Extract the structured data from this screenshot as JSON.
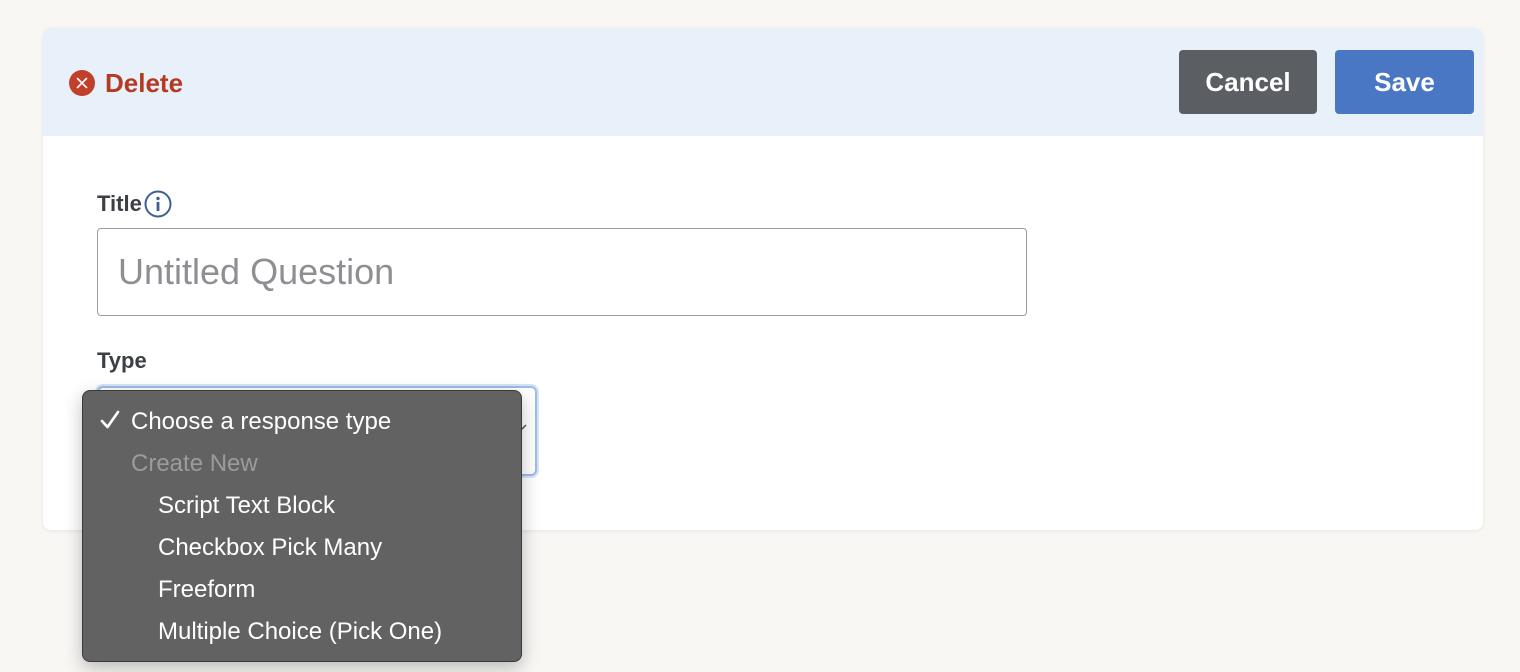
{
  "header": {
    "delete_label": "Delete",
    "cancel_label": "Cancel",
    "save_label": "Save"
  },
  "form": {
    "title_label": "Title",
    "title_placeholder": "Untitled Question",
    "title_value": "",
    "type_label": "Type"
  },
  "type_dropdown": {
    "selected": "Choose a response type",
    "group_label": "Create New",
    "options": [
      "Script Text Block",
      "Checkbox Pick Many",
      "Freeform",
      "Multiple Choice (Pick One)"
    ]
  },
  "icons": {
    "delete": "close-circle-icon",
    "info": "info-icon",
    "check": "checkmark-icon",
    "chevron": "chevron-down-icon"
  },
  "colors": {
    "delete": "#b63a22",
    "save": "#4a77c4",
    "cancel": "#5b5e63",
    "header_bg": "#e8f0fa",
    "dropdown_bg": "#626262"
  }
}
